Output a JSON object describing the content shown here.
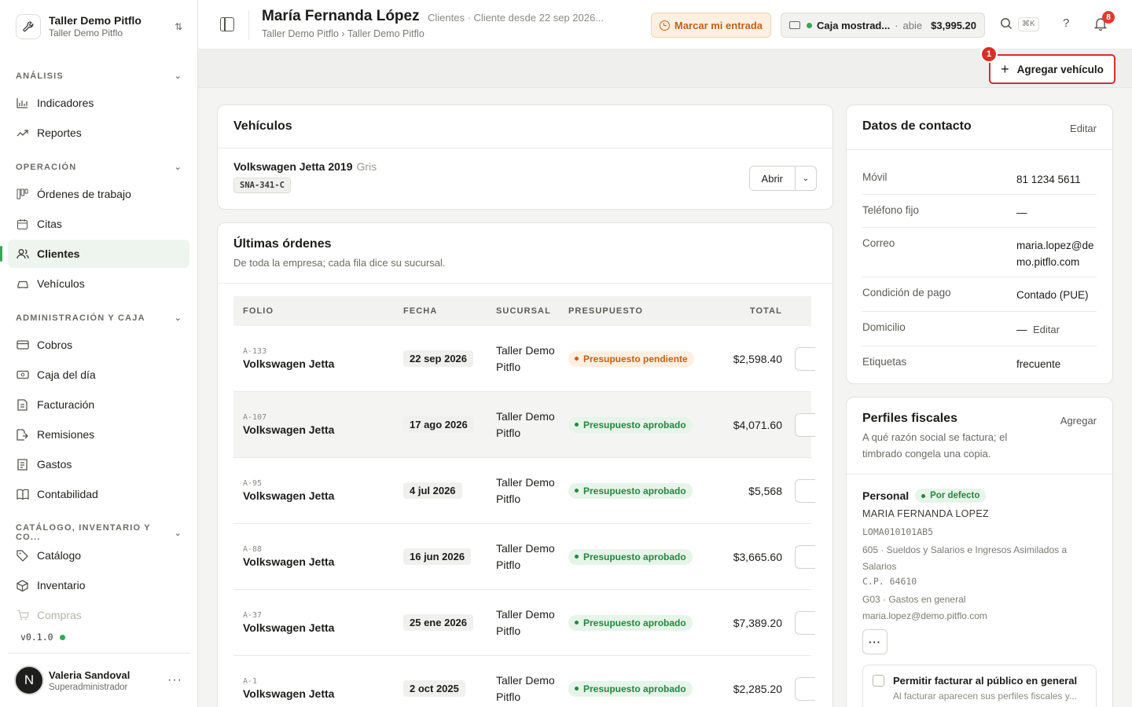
{
  "org": {
    "name": "Taller Demo Pitflo",
    "subtitle": "Taller Demo Pitflo"
  },
  "nav": {
    "sections": [
      {
        "label": "ANÁLISIS"
      },
      {
        "label": "OPERACIÓN"
      },
      {
        "label": "ADMINISTRACIÓN Y CAJA"
      },
      {
        "label": "CATÁLOGO, INVENTARIO Y CO..."
      }
    ],
    "items": [
      {
        "label": "Indicadores",
        "icon": "bar-chart-icon"
      },
      {
        "label": "Reportes",
        "icon": "trend-icon"
      },
      {
        "label": "Órdenes de trabajo",
        "icon": "kanban-icon"
      },
      {
        "label": "Citas",
        "icon": "calendar-icon"
      },
      {
        "label": "Clientes",
        "icon": "users-icon"
      },
      {
        "label": "Vehículos",
        "icon": "car-icon"
      },
      {
        "label": "Cobros",
        "icon": "card-icon"
      },
      {
        "label": "Caja del día",
        "icon": "cash-icon"
      },
      {
        "label": "Facturación",
        "icon": "invoice-icon"
      },
      {
        "label": "Remisiones",
        "icon": "remission-icon"
      },
      {
        "label": "Gastos",
        "icon": "receipt-icon"
      },
      {
        "label": "Contabilidad",
        "icon": "book-icon"
      },
      {
        "label": "Catálogo",
        "icon": "tag-icon"
      },
      {
        "label": "Inventario",
        "icon": "box-icon"
      },
      {
        "label": "Compras",
        "icon": "cart-icon"
      }
    ],
    "active": "Clientes"
  },
  "version": "v0.1.0",
  "user": {
    "name": "Valeria Sandoval",
    "role": "Superadministrador",
    "initial": "N"
  },
  "header": {
    "title": "María Fernanda López",
    "meta": "Clientes · Cliente desde 22 sep 2026...",
    "breadcrumb": "Taller Demo Pitflo › Taller Demo Pitflo",
    "checkin_label": "Marcar mi entrada",
    "register_name": "Caja mostrad...",
    "register_state": "abie",
    "register_amount": "$3,995.20",
    "shortcut": "⌘K",
    "help": "?",
    "notifications": "8"
  },
  "actions": {
    "add_vehicle": "Agregar vehículo",
    "marker": "1"
  },
  "vehicles": {
    "title": "Vehículos",
    "items": [
      {
        "name": "Volkswagen Jetta 2019",
        "color": "Gris",
        "plate": "SNA-341-C",
        "open_label": "Abrir"
      }
    ]
  },
  "orders": {
    "title": "Últimas órdenes",
    "subtitle": "De toda la empresa; cada fila dice su sucursal.",
    "columns": {
      "folio": "FOLIO",
      "fecha": "FECHA",
      "sucursal": "SUCURSAL",
      "presupuesto": "PRESUPUESTO",
      "total": "TOTAL"
    },
    "rows": [
      {
        "folio": "A-133",
        "vehicle": "Volkswagen Jetta",
        "date": "22 sep 2026",
        "branch": "Taller Demo Pitflo",
        "status": "Presupuesto pendiente",
        "total": "$2,598.40"
      },
      {
        "folio": "A-107",
        "vehicle": "Volkswagen Jetta",
        "date": "17 ago 2026",
        "branch": "Taller Demo Pitflo",
        "status": "Presupuesto aprobado",
        "total": "$4,071.60"
      },
      {
        "folio": "A-95",
        "vehicle": "Volkswagen Jetta",
        "date": "4 jul 2026",
        "branch": "Taller Demo Pitflo",
        "status": "Presupuesto aprobado",
        "total": "$5,568"
      },
      {
        "folio": "A-88",
        "vehicle": "Volkswagen Jetta",
        "date": "16 jun 2026",
        "branch": "Taller Demo Pitflo",
        "status": "Presupuesto aprobado",
        "total": "$3,665.60"
      },
      {
        "folio": "A-37",
        "vehicle": "Volkswagen Jetta",
        "date": "25 ene 2026",
        "branch": "Taller Demo Pitflo",
        "status": "Presupuesto aprobado",
        "total": "$7,389.20"
      },
      {
        "folio": "A-1",
        "vehicle": "Volkswagen Jetta",
        "date": "2 oct 2025",
        "branch": "Taller Demo Pitflo",
        "status": "Presupuesto aprobado",
        "total": "$2,285.20"
      }
    ]
  },
  "contact": {
    "title": "Datos de contacto",
    "edit_label": "Editar",
    "fields": [
      {
        "label": "Móvil",
        "value": "81 1234 5611"
      },
      {
        "label": "Teléfono fijo",
        "value": "—"
      },
      {
        "label": "Correo",
        "value": "maria.lopez@demo.pitflo.com"
      },
      {
        "label": "Condición de pago",
        "value": "Contado (PUE)"
      },
      {
        "label": "Domicilio",
        "value": "—",
        "action": "Editar"
      },
      {
        "label": "Etiquetas",
        "value": "frecuente"
      }
    ]
  },
  "fiscal": {
    "title": "Perfiles fiscales",
    "add_label": "Agregar",
    "subtitle": "A qué razón social se factura; el timbrado congela una copia.",
    "profile": {
      "name": "Personal",
      "default_badge": "Por defecto",
      "legal_name": "MARIA FERNANDA LOPEZ",
      "rfc": "LOMA010101AB5",
      "regime": "605 · Sueldos y Salarios e Ingresos Asimilados a Salarios",
      "zip": "C.P. 64610",
      "use": "G03 · Gastos en general",
      "email": "maria.lopez@demo.pitflo.com"
    },
    "public_toggle": {
      "label": "Permitir facturar al público en general",
      "hint": "Al facturar aparecen sus perfiles fiscales y..."
    }
  },
  "colors": {
    "accent_green": "#2faa54",
    "alert_red": "#d93025",
    "warning_orange": "#c2611a"
  }
}
